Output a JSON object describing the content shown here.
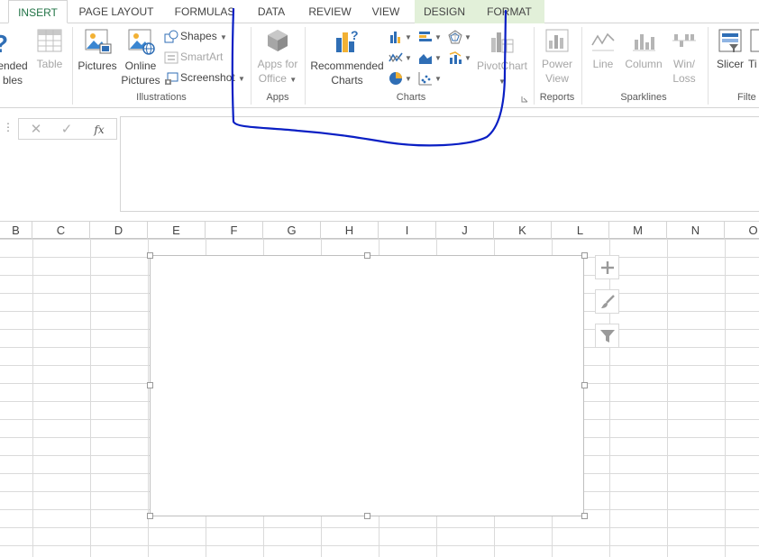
{
  "tabs": {
    "insert": "INSERT",
    "page_layout": "PAGE LAYOUT",
    "formulas": "FORMULAS",
    "data": "DATA",
    "review": "REVIEW",
    "view": "VIEW",
    "design": "DESIGN",
    "format": "FORMAT"
  },
  "ribbon": {
    "tables": {
      "recommended_pivot_line1": "ended",
      "recommended_pivot_line2": "bles",
      "table": "Table"
    },
    "illustrations": {
      "label": "Illustrations",
      "pictures": "Pictures",
      "online_pictures_line1": "Online",
      "online_pictures_line2": "Pictures",
      "shapes": "Shapes",
      "smartart": "SmartArt",
      "screenshot": "Screenshot"
    },
    "apps": {
      "label": "Apps",
      "apps_for_office_line1": "Apps for",
      "apps_for_office_line2": "Office"
    },
    "charts": {
      "label": "Charts",
      "recommended_charts_line1": "Recommended",
      "recommended_charts_line2": "Charts",
      "pivotchart": "PivotChart"
    },
    "reports": {
      "label": "Reports",
      "power_view_line1": "Power",
      "power_view_line2": "View"
    },
    "sparklines": {
      "label": "Sparklines",
      "line": "Line",
      "column": "Column",
      "winloss_line1": "Win/",
      "winloss_line2": "Loss"
    },
    "filters": {
      "label": "Filte",
      "slicer": "Slicer",
      "timeline": "Ti"
    }
  },
  "formula_bar": {
    "dots": "⋮",
    "cancel": "✕",
    "enter": "✓",
    "fx": "fx",
    "value": ""
  },
  "columns": [
    "B",
    "C",
    "D",
    "E",
    "F",
    "G",
    "H",
    "I",
    "J",
    "K",
    "L",
    "M",
    "N",
    "O"
  ],
  "icons": {
    "chart_elements": "plus-icon",
    "chart_styles": "paintbrush-icon",
    "chart_filters": "funnel-icon"
  },
  "colors": {
    "active_tab": "#217346",
    "context_tab_bg": "#e2f0d9",
    "annotation": "#0a1fc4"
  }
}
